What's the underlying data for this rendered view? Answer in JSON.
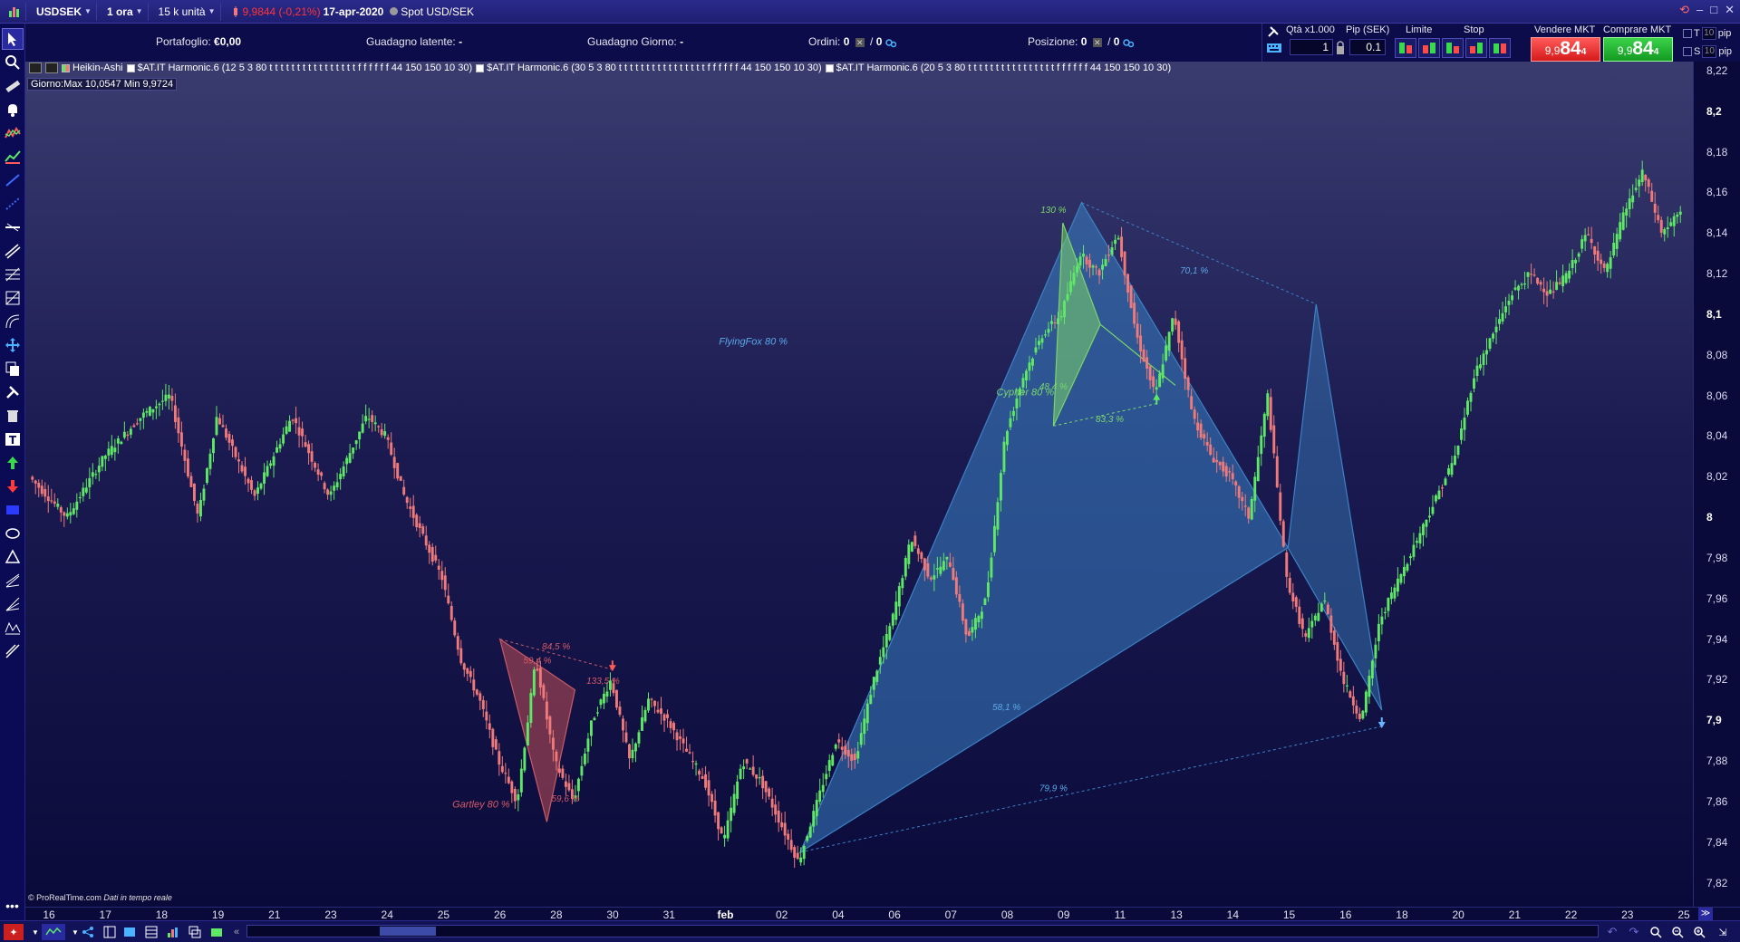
{
  "titlebar": {
    "symbol": "USDSEK",
    "timeframe": "1 ora",
    "units": "15 k unità",
    "price_change": "9,9844 (-0,21%)",
    "date": "17-apr-2020",
    "instrument": "Spot USD/SEK"
  },
  "infobar": {
    "portafoglio_label": "Portafoglio:",
    "portafoglio_value": "€0,00",
    "guadagno_latente_label": "Guadagno latente:",
    "guadagno_latente_value": "-",
    "guadagno_giorno_label": "Guadagno Giorno:",
    "guadagno_giorno_value": "-",
    "ordini_label": "Ordini:",
    "ordini_value": "0",
    "ordini_value2": "0",
    "posizione_label": "Posizione:",
    "posizione_value": "0",
    "posizione_value2": "0"
  },
  "tradepanel": {
    "qty_label": "Qtà x1.000",
    "qty_value": "1",
    "pip_label": "Pip (SEK)",
    "pip_value": "0.1",
    "limite_label": "Limite",
    "stop_label": "Stop",
    "sell_label": "Vendere MKT",
    "sell_small": "9,9",
    "sell_big": "84",
    "sell_sup": "4",
    "buy_label": "Comprare MKT",
    "buy_small": "9,9",
    "buy_big": "84",
    "buy_sup": "4",
    "t_label": "T",
    "t_val": "10",
    "s_label": "S",
    "s_val": "10",
    "pip_unit": "pip"
  },
  "legend": {
    "ha": "Heikin-Ashi",
    "h1": "$AT.IT Harmonic.6 (12 5 3 80 t t t t t t t t t t t t t t t t f f f f f f 44 150 150 10 30)",
    "h2": "$AT.IT Harmonic.6 (30 5 3 80 t t t t t t t t t t t t t t t t f f f f f f 44 150 150 10 30)",
    "h3": "$AT.IT Harmonic.6 (20 5 3 80 t t t t t t t t t t t t t t t t f f f f f f 44 150 150 10 30)",
    "giorno": "Giorno:Max 10,0547 Min 9,9724"
  },
  "copyright": {
    "text": "© ProRealTime.com",
    "suffix": "Dati in tempo reale"
  },
  "colors": {
    "bull": "#5ee866",
    "bear": "#f07a7a",
    "pattern_blue": "#3b82c4",
    "pattern_red": "#b34a55",
    "pattern_green": "#7ad66a"
  },
  "chart_data": {
    "type": "candlestick",
    "chart_style": "Heikin-Ashi",
    "ylim": [
      7.81,
      8.22
    ],
    "y_ticks": [
      "8,22",
      "8,2",
      "8,18",
      "8,16",
      "8,14",
      "8,12",
      "8,1",
      "8,08",
      "8,06",
      "8,04",
      "8,02",
      "8",
      "7,98",
      "7,96",
      "7,94",
      "7,92",
      "7,9",
      "7,88",
      "7,86",
      "7,84",
      "7,82"
    ],
    "y_major": [
      "8,2",
      "8,1",
      "8",
      "7,9"
    ],
    "x_ticks": [
      "16",
      "17",
      "18",
      "19",
      "21",
      "23",
      "24",
      "25",
      "26",
      "28",
      "30",
      "31",
      "feb",
      "02",
      "04",
      "06",
      "07",
      "08",
      "09",
      "11",
      "13",
      "14",
      "15",
      "16",
      "18",
      "20",
      "21",
      "22",
      "23",
      "25"
    ],
    "x_major": [
      "feb"
    ],
    "price_path": [
      [
        0,
        8.02
      ],
      [
        2,
        8.0
      ],
      [
        4,
        8.03
      ],
      [
        6,
        8.05
      ],
      [
        7.5,
        8.06
      ],
      [
        9,
        8.0
      ],
      [
        10,
        8.05
      ],
      [
        11,
        8.03
      ],
      [
        12,
        8.01
      ],
      [
        14,
        8.05
      ],
      [
        15,
        8.03
      ],
      [
        16,
        8.01
      ],
      [
        17,
        8.03
      ],
      [
        18,
        8.05
      ],
      [
        19,
        8.04
      ],
      [
        20,
        8.01
      ],
      [
        22,
        7.97
      ],
      [
        23,
        7.93
      ],
      [
        24,
        7.91
      ],
      [
        25,
        7.88
      ],
      [
        26,
        7.86
      ],
      [
        27,
        7.93
      ],
      [
        28,
        7.88
      ],
      [
        29,
        7.86
      ],
      [
        30,
        7.9
      ],
      [
        31,
        7.92
      ],
      [
        32,
        7.88
      ],
      [
        33,
        7.91
      ],
      [
        34,
        7.9
      ],
      [
        36,
        7.87
      ],
      [
        37,
        7.84
      ],
      [
        38,
        7.88
      ],
      [
        39,
        7.87
      ],
      [
        40,
        7.85
      ],
      [
        41,
        7.83
      ],
      [
        42,
        7.86
      ],
      [
        43,
        7.89
      ],
      [
        44,
        7.88
      ],
      [
        45,
        7.92
      ],
      [
        46,
        7.95
      ],
      [
        47,
        7.99
      ],
      [
        48,
        7.97
      ],
      [
        49,
        7.98
      ],
      [
        50,
        7.94
      ],
      [
        51,
        7.96
      ],
      [
        52,
        8.04
      ],
      [
        53,
        8.07
      ],
      [
        54,
        8.09
      ],
      [
        55,
        8.1
      ],
      [
        56,
        8.13
      ],
      [
        57,
        8.12
      ],
      [
        58,
        8.14
      ],
      [
        59,
        8.09
      ],
      [
        60,
        8.06
      ],
      [
        61,
        8.1
      ],
      [
        62,
        8.05
      ],
      [
        63,
        8.03
      ],
      [
        64,
        8.02
      ],
      [
        65,
        8.0
      ],
      [
        66,
        8.06
      ],
      [
        67,
        7.97
      ],
      [
        68,
        7.94
      ],
      [
        69,
        7.96
      ],
      [
        70,
        7.92
      ],
      [
        71,
        7.9
      ],
      [
        72,
        7.95
      ],
      [
        73,
        7.97
      ],
      [
        74,
        7.99
      ],
      [
        75,
        8.01
      ],
      [
        76,
        8.03
      ],
      [
        77,
        8.07
      ],
      [
        78,
        8.09
      ],
      [
        79,
        8.11
      ],
      [
        80,
        8.12
      ],
      [
        81,
        8.11
      ],
      [
        82,
        8.12
      ],
      [
        83,
        8.14
      ],
      [
        84,
        8.12
      ],
      [
        85,
        8.15
      ],
      [
        86,
        8.17
      ],
      [
        87,
        8.14
      ],
      [
        88,
        8.15
      ]
    ],
    "patterns": [
      {
        "name": "Cypher",
        "label": "Cypher 80 %",
        "ratios": [
          "130 %",
          "48,4 %",
          "83,3 %"
        ]
      },
      {
        "name": "FlyingFox",
        "label": "FlyingFox 80 %",
        "ratios": [
          "70,1 %",
          "58,1 %",
          "79,9 %"
        ]
      },
      {
        "name": "Gartley",
        "label": "Gartley 80 %",
        "ratios": [
          "84,5 %",
          "59,4 %",
          "133,5 %",
          "59,6 %"
        ]
      }
    ]
  }
}
